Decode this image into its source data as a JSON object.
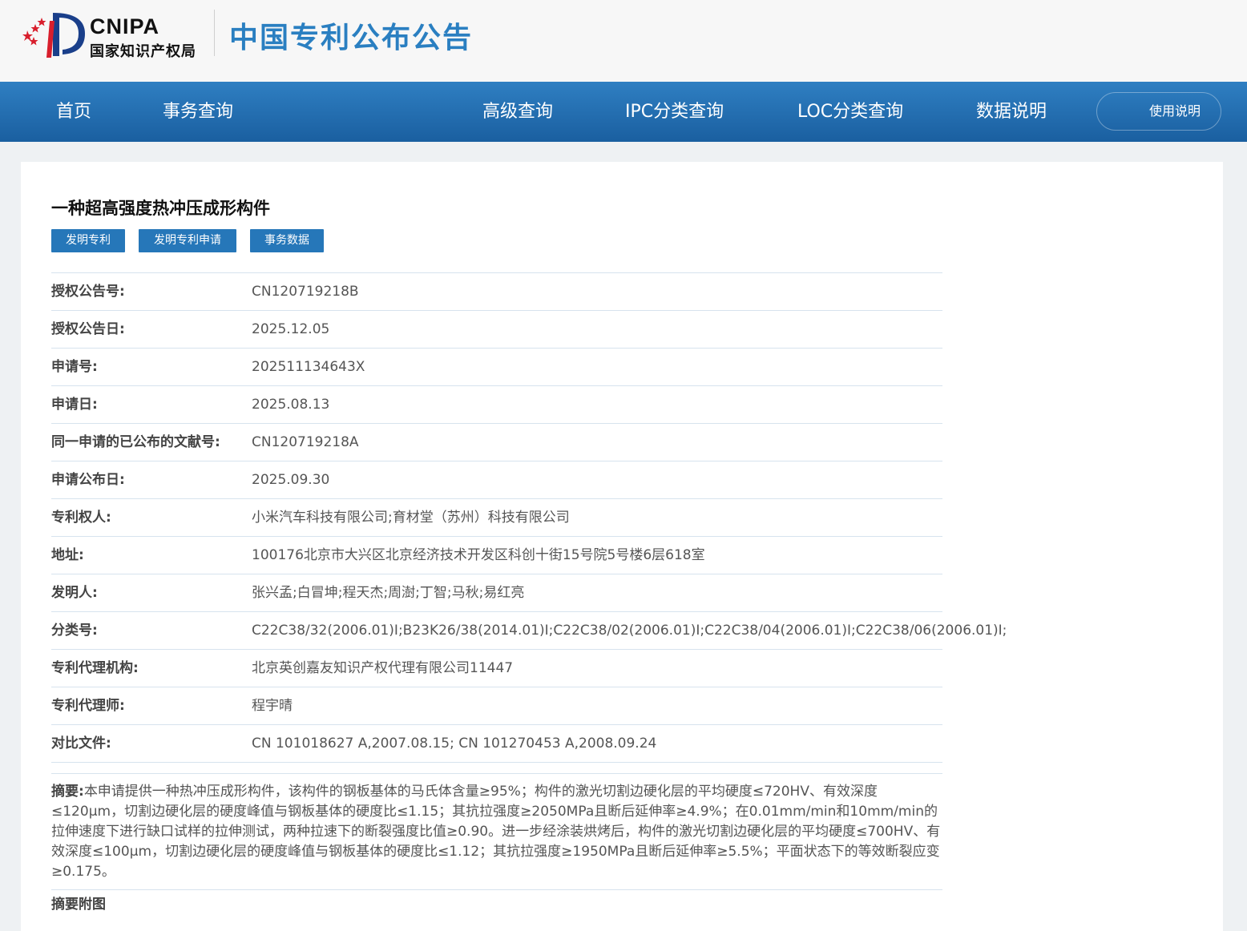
{
  "header": {
    "logo_en": "CNIPA",
    "logo_cn": "国家知识产权局",
    "site_title": "中国专利公布公告"
  },
  "nav": {
    "items": [
      "首页",
      "事务查询",
      "高级查询",
      "IPC分类查询",
      "LOC分类查询",
      "数据说明"
    ],
    "help_label": "使用说明"
  },
  "patent": {
    "title": "一种超高强度热冲压成形构件",
    "tags": [
      "发明专利",
      "发明专利申请",
      "事务数据"
    ],
    "fields": [
      {
        "label": "授权公告号:",
        "value": "CN120719218B"
      },
      {
        "label": "授权公告日:",
        "value": "2025.12.05"
      },
      {
        "label": "申请号:",
        "value": "202511134643X"
      },
      {
        "label": "申请日:",
        "value": "2025.08.13"
      },
      {
        "label": "同一申请的已公布的文献号:",
        "value": "CN120719218A"
      },
      {
        "label": "申请公布日:",
        "value": "2025.09.30"
      },
      {
        "label": "专利权人:",
        "value": "小米汽车科技有限公司;育材堂（苏州）科技有限公司"
      },
      {
        "label": "地址:",
        "value": "100176北京市大兴区北京经济技术开发区科创十街15号院5号楼6层618室"
      },
      {
        "label": "发明人:",
        "value": "张兴孟;白冒坤;程天杰;周澍;丁智;马秋;易红亮"
      },
      {
        "label": "分类号:",
        "value": "C22C38/32(2006.01)I;B23K26/38(2014.01)I;C22C38/02(2006.01)I;C22C38/04(2006.01)I;C22C38/06(2006.01)I;"
      },
      {
        "label": "专利代理机构:",
        "value": "北京英创嘉友知识产权代理有限公司11447"
      },
      {
        "label": "专利代理师:",
        "value": "程宇晴"
      },
      {
        "label": "对比文件:",
        "value": "CN 101018627 A,2007.08.15; CN 101270453 A,2008.09.24"
      }
    ],
    "abstract_label": "摘要:",
    "abstract_text": "本申请提供一种热冲压成形构件，该构件的钢板基体的马氏体含量≥95%；构件的激光切割边硬化层的平均硬度≤720HV、有效深度≤120μm，切割边硬化层的硬度峰值与钢板基体的硬度比≤1.15；其抗拉强度≥2050MPa且断后延伸率≥4.9%；在0.01mm/min和10mm/min的拉伸速度下进行缺口试样的拉伸测试，两种拉速下的断裂强度比值≥0.90。进一步经涂装烘烤后，构件的激光切割边硬化层的平均硬度≤700HV、有效深度≤100μm，切割边硬化层的硬度峰值与钢板基体的硬度比≤1.12；其抗拉强度≥1950MPa且断后延伸率≥5.5%；平面状态下的等效断裂应变≥0.175。",
    "abstract_figure_label": "摘要附图"
  },
  "colors": {
    "nav_top": "#2f7fc2",
    "nav_bottom": "#1a5fa0",
    "tag_bg": "#2677b9",
    "title_blue": "#2a7fc1"
  }
}
